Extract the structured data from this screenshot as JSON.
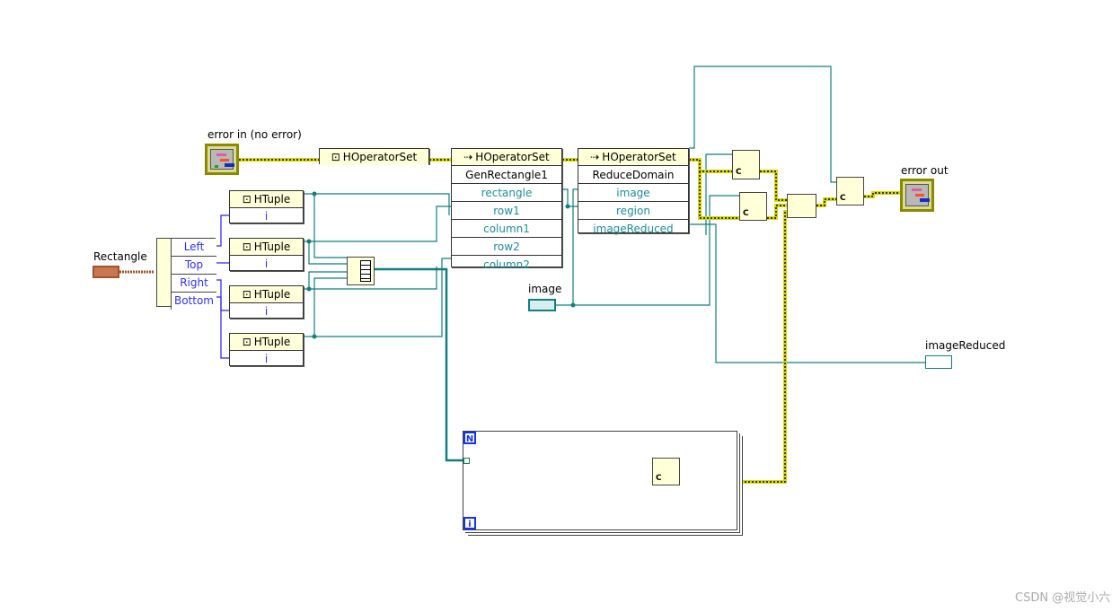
{
  "labels": {
    "error_in": "error in (no error)",
    "error_out": "error out",
    "rectangle": "Rectangle",
    "image": "image",
    "image_reduced": "imageReduced"
  },
  "open_node": {
    "title": "HOperatorSet"
  },
  "gen_rect": {
    "title": "HOperatorSet",
    "method": "GenRectangle1",
    "rows": [
      "rectangle",
      "row1",
      "column1",
      "row2",
      "column2"
    ]
  },
  "reduce": {
    "title": "HOperatorSet",
    "method": "ReduceDomain",
    "rows": [
      "image",
      "region",
      "imageReduced"
    ]
  },
  "unbundle": {
    "items": [
      "Left",
      "Top",
      "Right",
      "Bottom"
    ]
  },
  "htuples": [
    {
      "title": "HTuple",
      "input": "i"
    },
    {
      "title": "HTuple",
      "input": "i"
    },
    {
      "title": "HTuple",
      "input": "i"
    },
    {
      "title": "HTuple",
      "input": "i"
    }
  ],
  "close_ref": {
    "top": "C"
  },
  "loop": {
    "count_terminal": "N",
    "iteration_terminal": "i"
  },
  "watermark": "CSDN @视觉小六",
  "colors": {
    "wire_refnum": "#0f7f7f",
    "wire_cluster_numeric": "#2020ff",
    "wire_error": "#d8d800",
    "wire_rect": "#a0522d"
  }
}
